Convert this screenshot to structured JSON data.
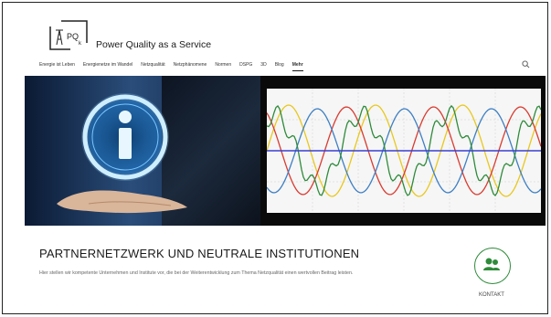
{
  "brand": {
    "name": "Power Quality as a Service",
    "logo_letters": "PQk"
  },
  "nav": {
    "items": [
      {
        "label": "Energie ist Leben",
        "active": false
      },
      {
        "label": "Energienetze im Wandel",
        "active": false
      },
      {
        "label": "Netzqualität",
        "active": false
      },
      {
        "label": "Netzphänomene",
        "active": false
      },
      {
        "label": "Normen",
        "active": false
      },
      {
        "label": "DSPG",
        "active": false
      },
      {
        "label": "3D",
        "active": false
      },
      {
        "label": "Blog",
        "active": false
      },
      {
        "label": "Mehr",
        "active": true
      }
    ],
    "search_icon": "search-icon"
  },
  "hero": {
    "info_icon": "info-icon",
    "waveform_colors": [
      "#e8c81e",
      "#d93b30",
      "#3d7fc4",
      "#2e8b3a",
      "#3a3fd0"
    ]
  },
  "main": {
    "title": "PARTNERNETZWERK UND NEUTRALE INSTITUTIONEN",
    "intro": "Hier stellen wir kompetente Unternehmen und Institute vor, die bei der Weiterentwicklung zum Thema Netzqualität einen wertvollen Beitrag leisten."
  },
  "contact": {
    "label": "KONTAKT",
    "icon": "people-icon",
    "color": "#2e8b3a"
  }
}
